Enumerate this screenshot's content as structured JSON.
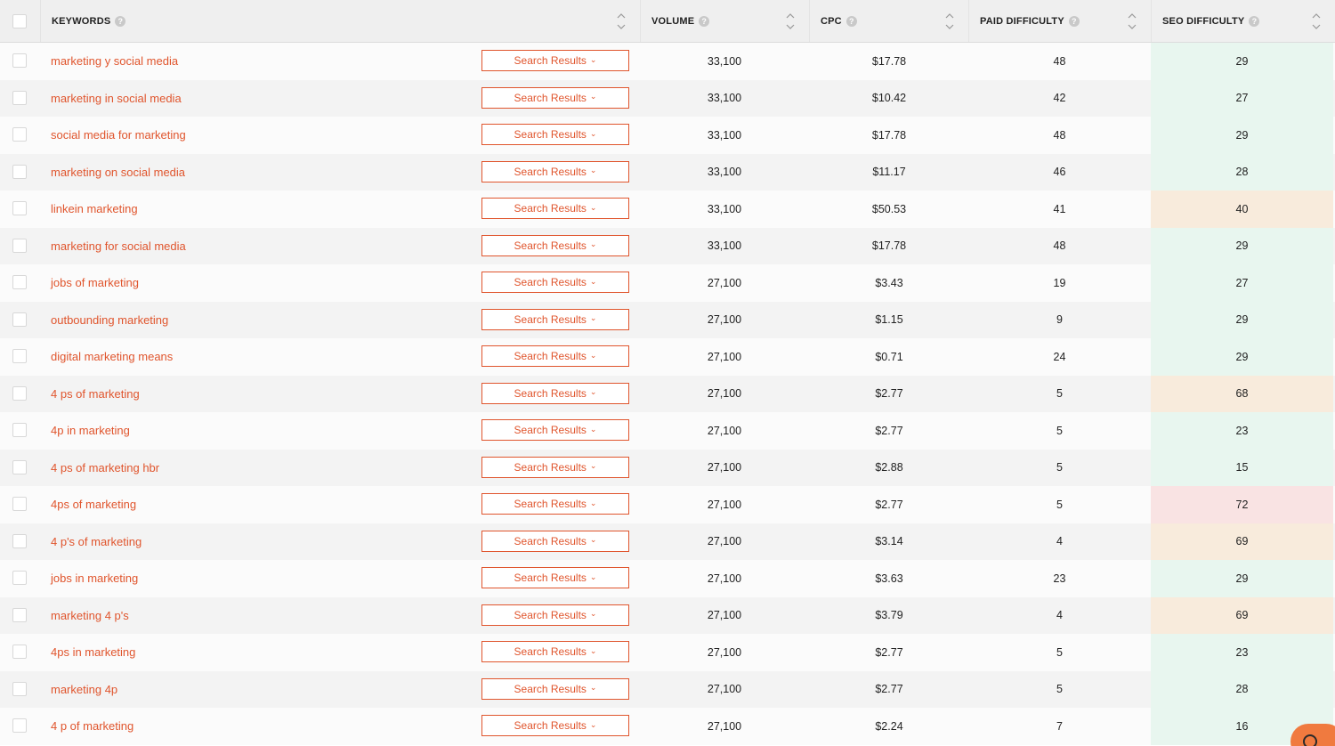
{
  "header": {
    "columns": [
      {
        "label": "KEYWORDS",
        "help": "?"
      },
      {
        "label": "VOLUME",
        "help": "?"
      },
      {
        "label": "CPC",
        "help": "?"
      },
      {
        "label": "PAID DIFFICULTY",
        "help": "?"
      },
      {
        "label": "SEO DIFFICULTY",
        "help": "?"
      }
    ]
  },
  "colors": {
    "accent": "#e0552d",
    "seo_easy": "#e8f6ef",
    "seo_medium": "#f8ebdc",
    "seo_hard": "#f9e3e3"
  },
  "search_results_label": "Search Results",
  "rows": [
    {
      "keyword": "marketing y social media",
      "volume": "33,100",
      "cpc": "$17.78",
      "paid": "48",
      "seo": "29",
      "seo_level": "easy"
    },
    {
      "keyword": "marketing in social media",
      "volume": "33,100",
      "cpc": "$10.42",
      "paid": "42",
      "seo": "27",
      "seo_level": "easy"
    },
    {
      "keyword": "social media for marketing",
      "volume": "33,100",
      "cpc": "$17.78",
      "paid": "48",
      "seo": "29",
      "seo_level": "easy"
    },
    {
      "keyword": "marketing on social media",
      "volume": "33,100",
      "cpc": "$11.17",
      "paid": "46",
      "seo": "28",
      "seo_level": "easy"
    },
    {
      "keyword": "linkein marketing",
      "volume": "33,100",
      "cpc": "$50.53",
      "paid": "41",
      "seo": "40",
      "seo_level": "medium"
    },
    {
      "keyword": "marketing for social media",
      "volume": "33,100",
      "cpc": "$17.78",
      "paid": "48",
      "seo": "29",
      "seo_level": "easy"
    },
    {
      "keyword": "jobs of marketing",
      "volume": "27,100",
      "cpc": "$3.43",
      "paid": "19",
      "seo": "27",
      "seo_level": "easy"
    },
    {
      "keyword": "outbounding marketing",
      "volume": "27,100",
      "cpc": "$1.15",
      "paid": "9",
      "seo": "29",
      "seo_level": "easy"
    },
    {
      "keyword": "digital marketing means",
      "volume": "27,100",
      "cpc": "$0.71",
      "paid": "24",
      "seo": "29",
      "seo_level": "easy"
    },
    {
      "keyword": "4 ps of marketing",
      "volume": "27,100",
      "cpc": "$2.77",
      "paid": "5",
      "seo": "68",
      "seo_level": "medium"
    },
    {
      "keyword": "4p in marketing",
      "volume": "27,100",
      "cpc": "$2.77",
      "paid": "5",
      "seo": "23",
      "seo_level": "easy"
    },
    {
      "keyword": "4 ps of marketing hbr",
      "volume": "27,100",
      "cpc": "$2.88",
      "paid": "5",
      "seo": "15",
      "seo_level": "easy"
    },
    {
      "keyword": "4ps of marketing",
      "volume": "27,100",
      "cpc": "$2.77",
      "paid": "5",
      "seo": "72",
      "seo_level": "hard"
    },
    {
      "keyword": "4 p's of marketing",
      "volume": "27,100",
      "cpc": "$3.14",
      "paid": "4",
      "seo": "69",
      "seo_level": "medium"
    },
    {
      "keyword": "jobs in marketing",
      "volume": "27,100",
      "cpc": "$3.63",
      "paid": "23",
      "seo": "29",
      "seo_level": "easy"
    },
    {
      "keyword": "marketing 4 p's",
      "volume": "27,100",
      "cpc": "$3.79",
      "paid": "4",
      "seo": "69",
      "seo_level": "medium"
    },
    {
      "keyword": "4ps in marketing",
      "volume": "27,100",
      "cpc": "$2.77",
      "paid": "5",
      "seo": "23",
      "seo_level": "easy"
    },
    {
      "keyword": "marketing 4p",
      "volume": "27,100",
      "cpc": "$2.77",
      "paid": "5",
      "seo": "28",
      "seo_level": "easy"
    },
    {
      "keyword": "4 p of marketing",
      "volume": "27,100",
      "cpc": "$2.24",
      "paid": "7",
      "seo": "16",
      "seo_level": "easy"
    }
  ]
}
